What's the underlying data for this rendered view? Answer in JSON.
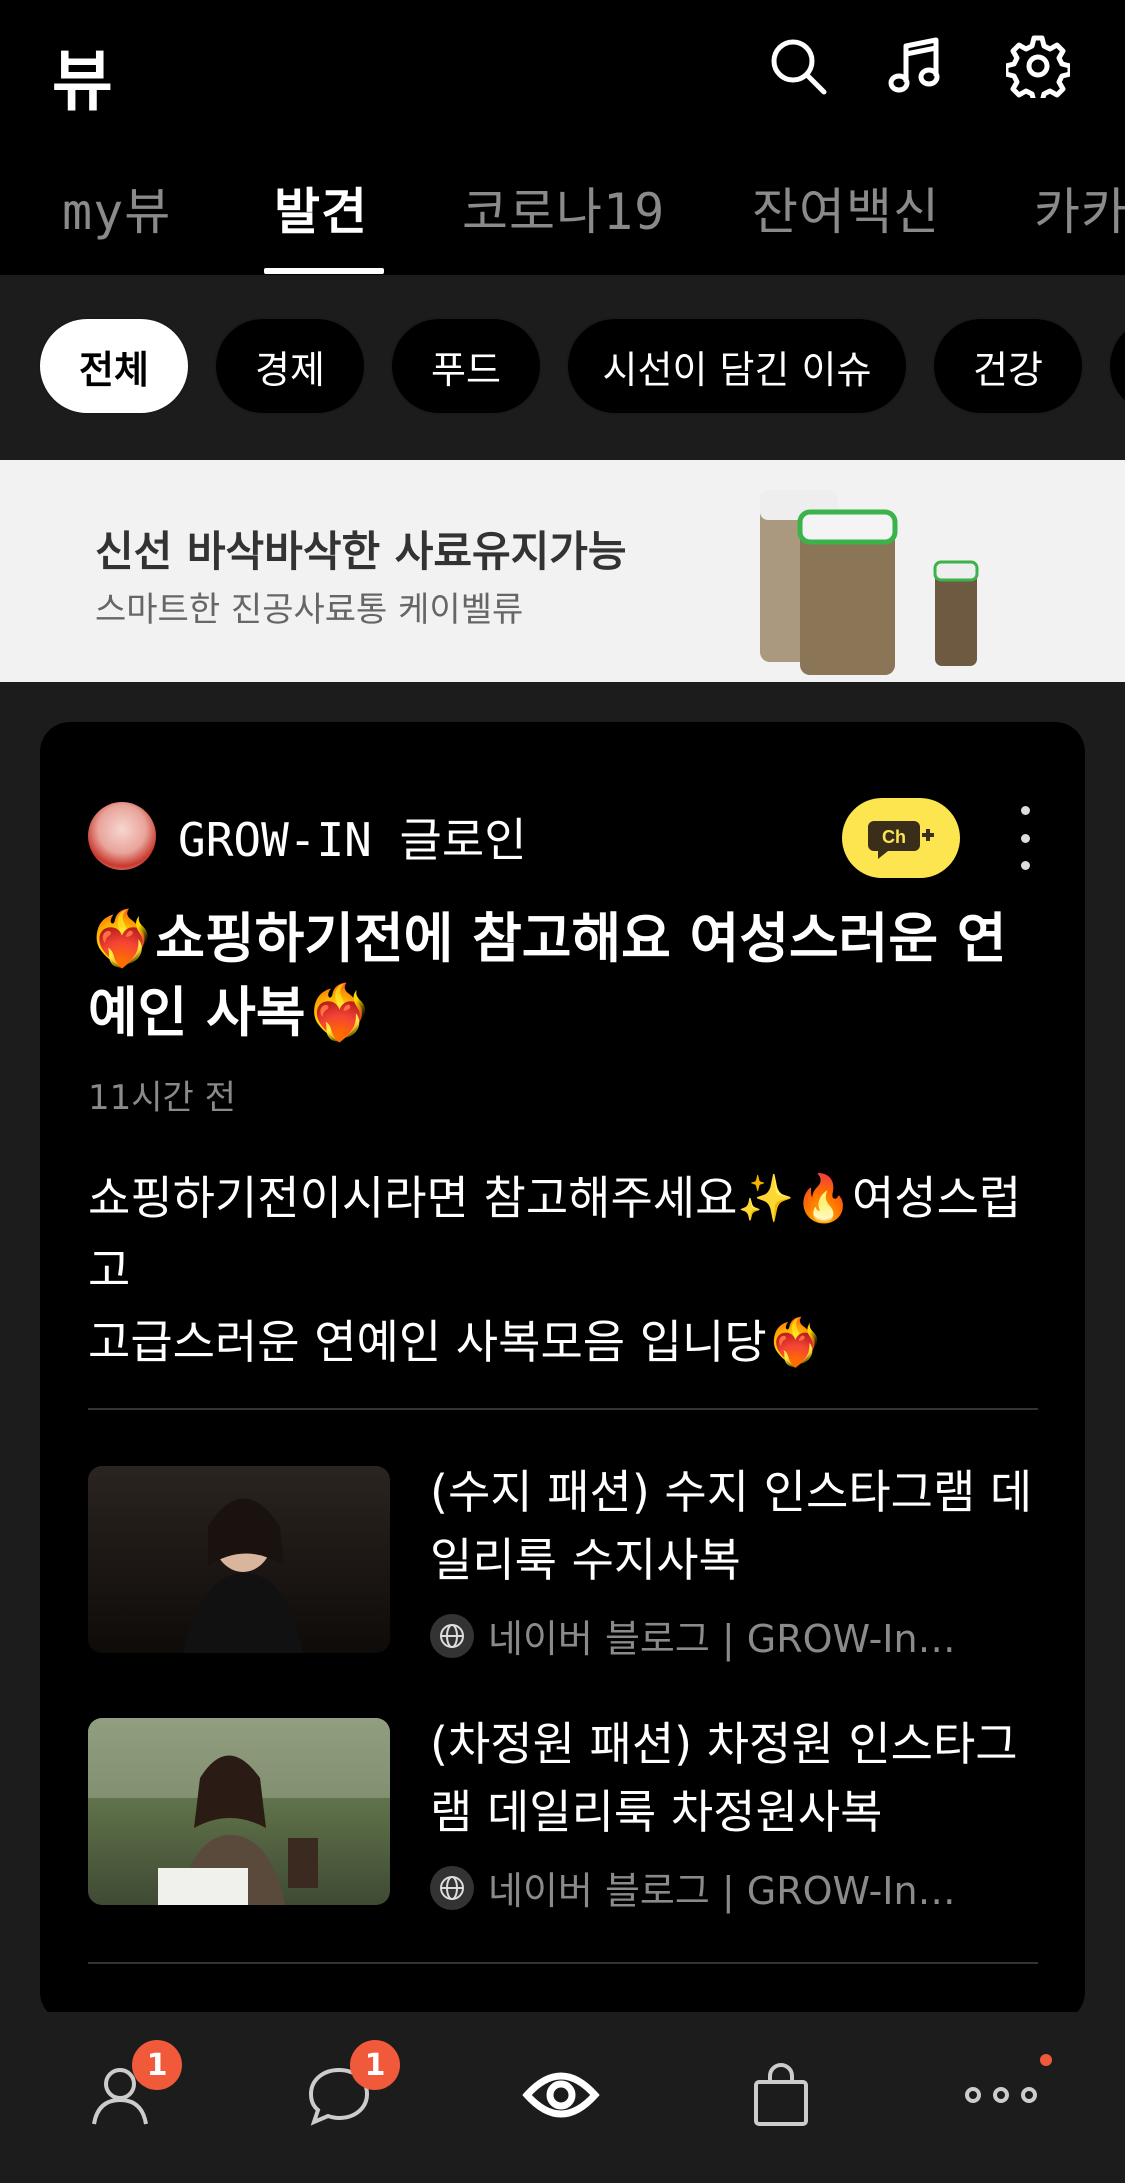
{
  "header": {
    "title": "뷰",
    "icons": [
      "search-icon",
      "music-note-icon",
      "gear-icon"
    ]
  },
  "tabs": [
    {
      "label": "my뷰",
      "active": false
    },
    {
      "label": "발견",
      "active": true
    },
    {
      "label": "코로나19",
      "active": false
    },
    {
      "label": "잔여백신",
      "active": false
    },
    {
      "label": "카카",
      "active": false
    }
  ],
  "chips": [
    {
      "label": "전체",
      "active": true
    },
    {
      "label": "경제",
      "active": false
    },
    {
      "label": "푸드",
      "active": false
    },
    {
      "label": "시선이 담긴 이슈",
      "active": false
    },
    {
      "label": "건강",
      "active": false
    }
  ],
  "ad": {
    "title": "신선 바삭바삭한 사료유지가능",
    "subtitle": "스마트한 진공사료통 케이벨류"
  },
  "post": {
    "channel_name": "GROW-IN 글로인",
    "title": "❤️‍🔥쇼핑하기전에 참고해요 여성스러운 연예인 사복❤️‍🔥",
    "time": "11시간 전",
    "body_line1": "쇼핑하기전이시라면 참고해주세요✨🔥여성스럽고",
    "body_line2": "고급스러운 연예인 사복모음 입니당❤️‍🔥",
    "links": [
      {
        "title": "(수지 패션) 수지 인스타그램 데일리룩 수지사복",
        "meta": "네이버 블로그 | GROW-In…"
      },
      {
        "title": "(차정원 패션) 차정원 인스타그램 데일리룩 차정원사복",
        "meta": "네이버 블로그 | GROW-In…"
      }
    ]
  },
  "bottom_nav": {
    "friends_badge": "1",
    "chats_badge": "1"
  },
  "colors": {
    "accent_yellow": "#fde54f",
    "badge_red": "#f05a3a"
  }
}
